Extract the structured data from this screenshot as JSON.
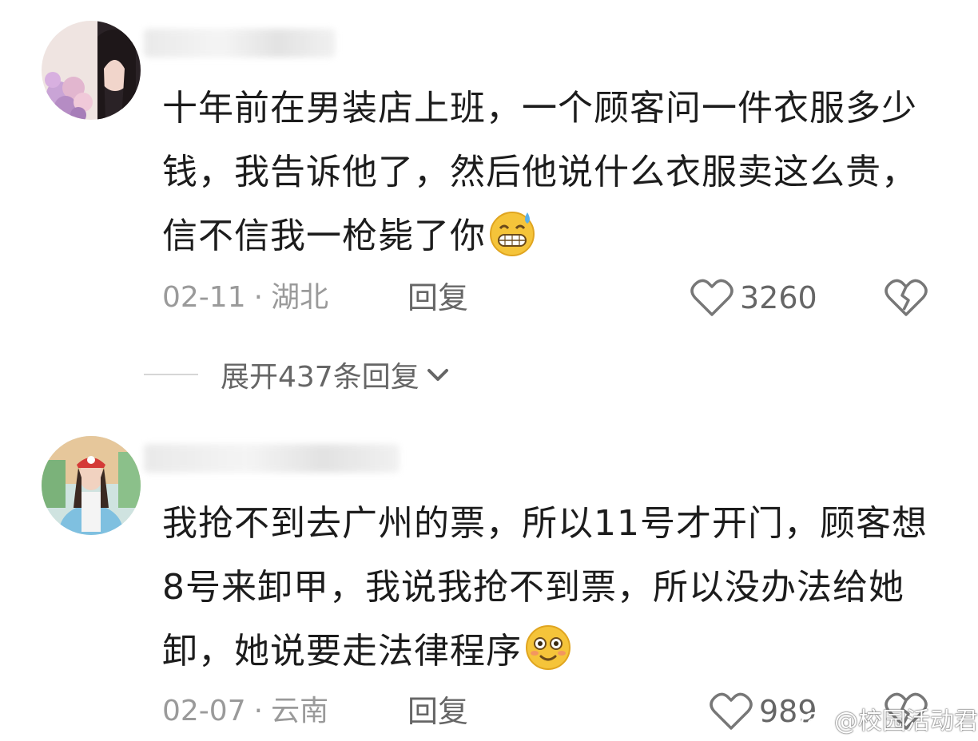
{
  "comments": [
    {
      "username": "",
      "text": "十年前在男装店上班，一个顾客问一件衣服多少钱，我告诉他了，然后他说什么衣服卖这么贵，信不信我一枪毙了你",
      "emoji": "grinning-sweat-emoji",
      "date": "02-11",
      "separator": "·",
      "location": "湖北",
      "reply_label": "回复",
      "likes": "3260"
    },
    {
      "username": "",
      "text": "我抢不到去广州的票，所以11号才开门，顾客想8号来卸甲，我说我抢不到票，所以没办法给她卸，她说要走法律程序",
      "emoji": "smiling-emoji",
      "date": "02-07",
      "separator": "·",
      "location": "云南",
      "reply_label": "回复",
      "likes": "989"
    }
  ],
  "expand_replies": {
    "label": "展开437条回复"
  },
  "watermark": {
    "text": "@校园活动君"
  },
  "colors": {
    "primary_text": "#1c1c1c",
    "meta_text": "#9a9a9a",
    "action_text": "#666666",
    "emoji_yellow": "#f5c43a"
  }
}
